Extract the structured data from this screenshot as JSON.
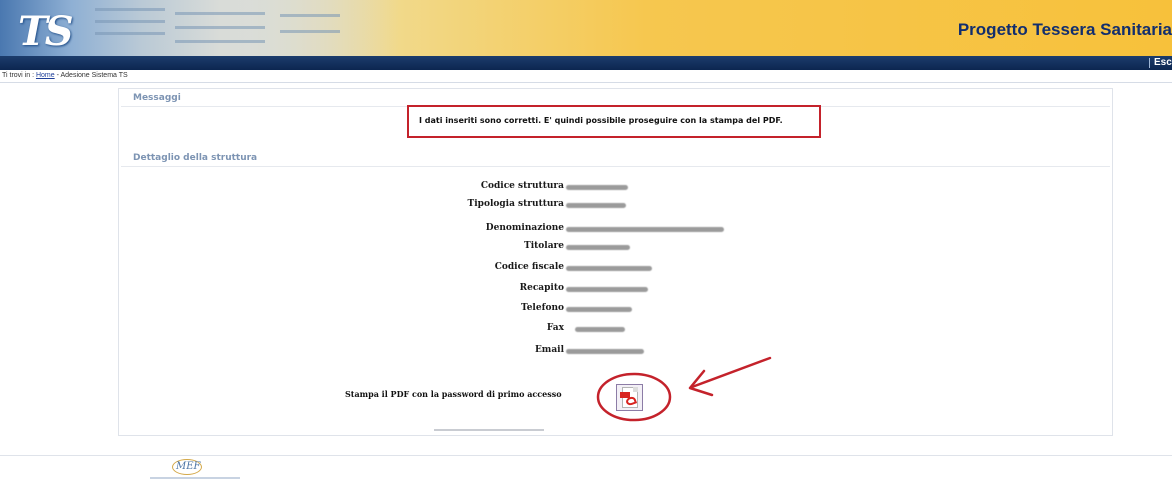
{
  "header": {
    "app_title": "Progetto Tessera Sanitaria",
    "logo_text": "TS",
    "exit_label": "Esci"
  },
  "breadcrumb": {
    "prefix": "Ti trovi in : ",
    "home_link": "Home",
    "separator": " - ",
    "current": "Adesione Sistema TS"
  },
  "messages": {
    "section_title": "Messaggi",
    "text": "I dati inseriti sono corretti. E' quindi possibile proseguire con la stampa del PDF."
  },
  "details": {
    "section_title": "Dettaglio della struttura",
    "fields": [
      {
        "label": "Codice struttura"
      },
      {
        "label": "Tipologia struttura"
      },
      {
        "label": "Denominazione"
      },
      {
        "label": "Titolare"
      },
      {
        "label": "Codice fiscale"
      },
      {
        "label": "Recapito"
      },
      {
        "label": "Telefono"
      },
      {
        "label": "Fax"
      },
      {
        "label": "Email"
      }
    ]
  },
  "print": {
    "label": "Stampa il PDF con la password di primo accesso",
    "icon": "pdf-icon"
  },
  "footer": {
    "logo_text": "MEF"
  },
  "colors": {
    "header_navy": "#0c2650",
    "title_navy": "#122e6e",
    "section_title": "#7d94b3",
    "annotation_red": "#c4222b"
  }
}
